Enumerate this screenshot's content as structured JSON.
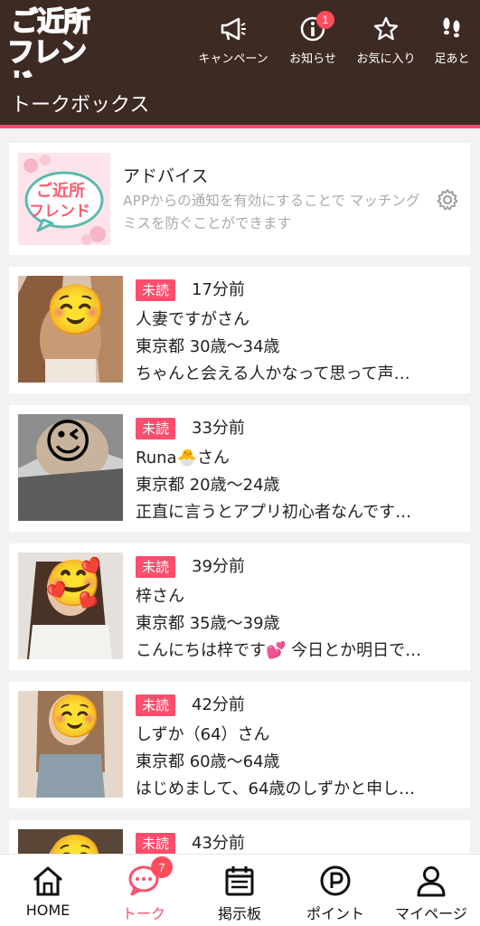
{
  "header": {
    "logo_line1": "ご近所",
    "logo_line2": "フレンド",
    "nav": [
      {
        "label": "キャンペーン",
        "icon": "megaphone-icon"
      },
      {
        "label": "お知らせ",
        "icon": "info-icon",
        "badge": "1"
      },
      {
        "label": "お気に入り",
        "icon": "star-icon"
      },
      {
        "label": "足あと",
        "icon": "footprints-icon"
      }
    ]
  },
  "subheader": {
    "title": "トークボックス"
  },
  "advice": {
    "logo_line1": "ご近所",
    "logo_line2": "フレンド",
    "title": "アドバイス",
    "text": "APPからの通知を有効にすることで マッチングミスを防ぐことができます"
  },
  "messages": [
    {
      "status": "未読",
      "time": "17分前",
      "name": "人妻ですがさん",
      "location": "東京都 30歳〜34歳",
      "preview": "ちゃんと会える人かなって思って声…",
      "emoji": "☺️"
    },
    {
      "status": "未読",
      "time": "33分前",
      "name": "Runa🐣さん",
      "location": "東京都 20歳〜24歳",
      "preview": "正直に言うとアプリ初心者なんです…",
      "emoji": "😉"
    },
    {
      "status": "未読",
      "time": "39分前",
      "name": "梓さん",
      "location": "東京都 35歳〜39歳",
      "preview": "こんにちは梓です💕 今日とか明日で…",
      "emoji": "🥰"
    },
    {
      "status": "未読",
      "time": "42分前",
      "name": "しずか（64）さん",
      "location": "東京都 60歳〜64歳",
      "preview": "はじめまして、64歳のしずかと申し…",
      "emoji": "☺️"
    },
    {
      "status": "未読",
      "time": "43分前",
      "name": "",
      "location": "",
      "preview": "",
      "emoji": "☺️"
    }
  ],
  "bottom_nav": [
    {
      "label": "HOME",
      "icon": "home-icon"
    },
    {
      "label": "トーク",
      "icon": "chat-icon",
      "badge": "7",
      "active": true
    },
    {
      "label": "掲示板",
      "icon": "board-icon"
    },
    {
      "label": "ポイント",
      "icon": "points-icon"
    },
    {
      "label": "マイページ",
      "icon": "user-icon"
    }
  ],
  "colors": {
    "header_bg": "#3d2a23",
    "accent": "#ff4d6d",
    "badge": "#ff4d5e"
  }
}
